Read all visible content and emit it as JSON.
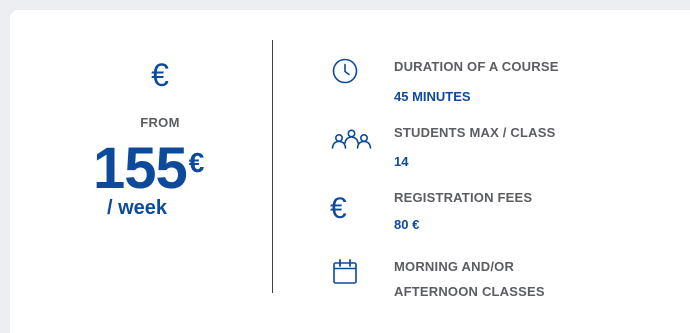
{
  "pricing": {
    "currency_icon": "euro-icon",
    "from_label": "FROM",
    "price_value": "155",
    "price_currency": "€",
    "period_label": "/ week"
  },
  "details": [
    {
      "icon": "clock-icon",
      "title": "DURATION OF A COURSE",
      "value": "45 MINUTES"
    },
    {
      "icon": "students-icon",
      "title": "STUDENTS MAX / CLASS",
      "value": "14"
    },
    {
      "icon": "euro-icon",
      "title": "REGISTRATION FEES",
      "value": "80 €"
    },
    {
      "icon": "calendar-icon",
      "title_line1": "MORNING AND/OR",
      "title_line2": "AFTERNOON CLASSES"
    }
  ],
  "colors": {
    "accent": "#0d4a9b",
    "label": "#5b5d61",
    "background": "#eceef2",
    "card": "#ffffff"
  }
}
